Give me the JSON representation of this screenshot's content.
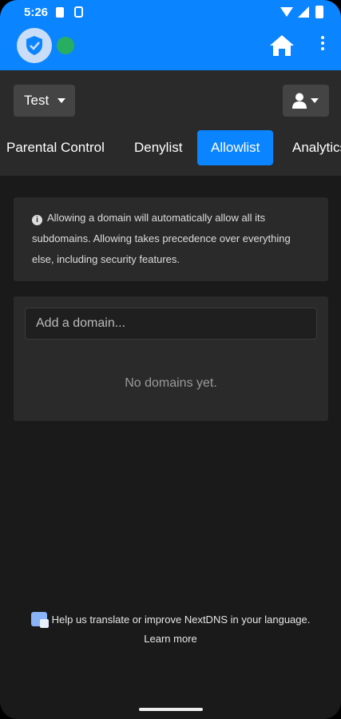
{
  "status_bar": {
    "time": "5:26"
  },
  "colors": {
    "accent": "#0a84ff",
    "ok": "#27ae60",
    "surface": "#2a2a2a",
    "background": "#1a1a1a"
  },
  "header": {
    "logo_icon": "shield-check-icon",
    "status_icon": "status-dot-icon",
    "home_icon": "home-icon",
    "menu_icon": "more-vert-icon"
  },
  "profile": {
    "name": "Test"
  },
  "tabs": [
    {
      "label": "Parental Control",
      "active": false
    },
    {
      "label": "Denylist",
      "active": false
    },
    {
      "label": "Allowlist",
      "active": true
    },
    {
      "label": "Analytics",
      "active": false
    }
  ],
  "info": {
    "text_line1": "Allowing a domain will automatically allow all its",
    "text_line2": "subdomains. Allowing takes precedence over everything",
    "text_line3": "else, including security features."
  },
  "allowlist": {
    "input_placeholder": "Add a domain...",
    "empty_text": "No domains yet."
  },
  "footer": {
    "translate_text": "Help us translate or improve NextDNS in your language.",
    "learn_more": "Learn more"
  }
}
